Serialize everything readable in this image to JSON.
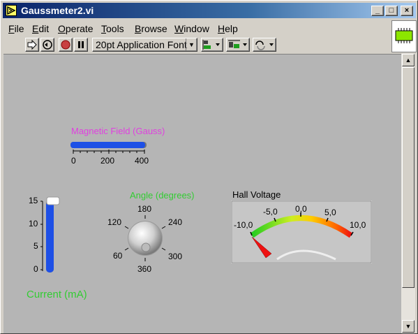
{
  "window": {
    "title": "Gaussmeter2.vi"
  },
  "titlebar_buttons": {
    "minimize": "_",
    "maximize": "□",
    "close": "×"
  },
  "menu": [
    {
      "label": "File",
      "key": "F"
    },
    {
      "label": "Edit",
      "key": "E"
    },
    {
      "label": "Operate",
      "key": "O"
    },
    {
      "label": "Tools",
      "key": "T"
    },
    {
      "label": "Browse",
      "key": "B"
    },
    {
      "label": "Window",
      "key": "W"
    },
    {
      "label": "Help",
      "key": "H"
    }
  ],
  "toolbar": {
    "font_label": "20pt Application Font"
  },
  "magnetic_field": {
    "label": "Magnetic Field (Gauss)",
    "ticks": [
      "0",
      "200",
      "400"
    ],
    "value": 400,
    "min": 0,
    "max": 400,
    "label_color": "#e040e0",
    "fill_color": "#1e50e6"
  },
  "current": {
    "label": "Current (mA)",
    "ticks": [
      "15",
      "10",
      "5",
      "0"
    ],
    "value": 15,
    "min": 0,
    "max": 15,
    "label_color": "#33cc33"
  },
  "angle": {
    "label": "Angle (degrees)",
    "ticks": [
      "180",
      "240",
      "300",
      "360",
      "60",
      "120"
    ],
    "value": 360,
    "label_color": "#33cc33"
  },
  "hall_voltage": {
    "label": "Hall Voltage",
    "ticks": [
      "-10,0",
      "-5,0",
      "0,0",
      "5,0",
      "10,0"
    ],
    "value": -10,
    "min": -10,
    "max": 10
  }
}
